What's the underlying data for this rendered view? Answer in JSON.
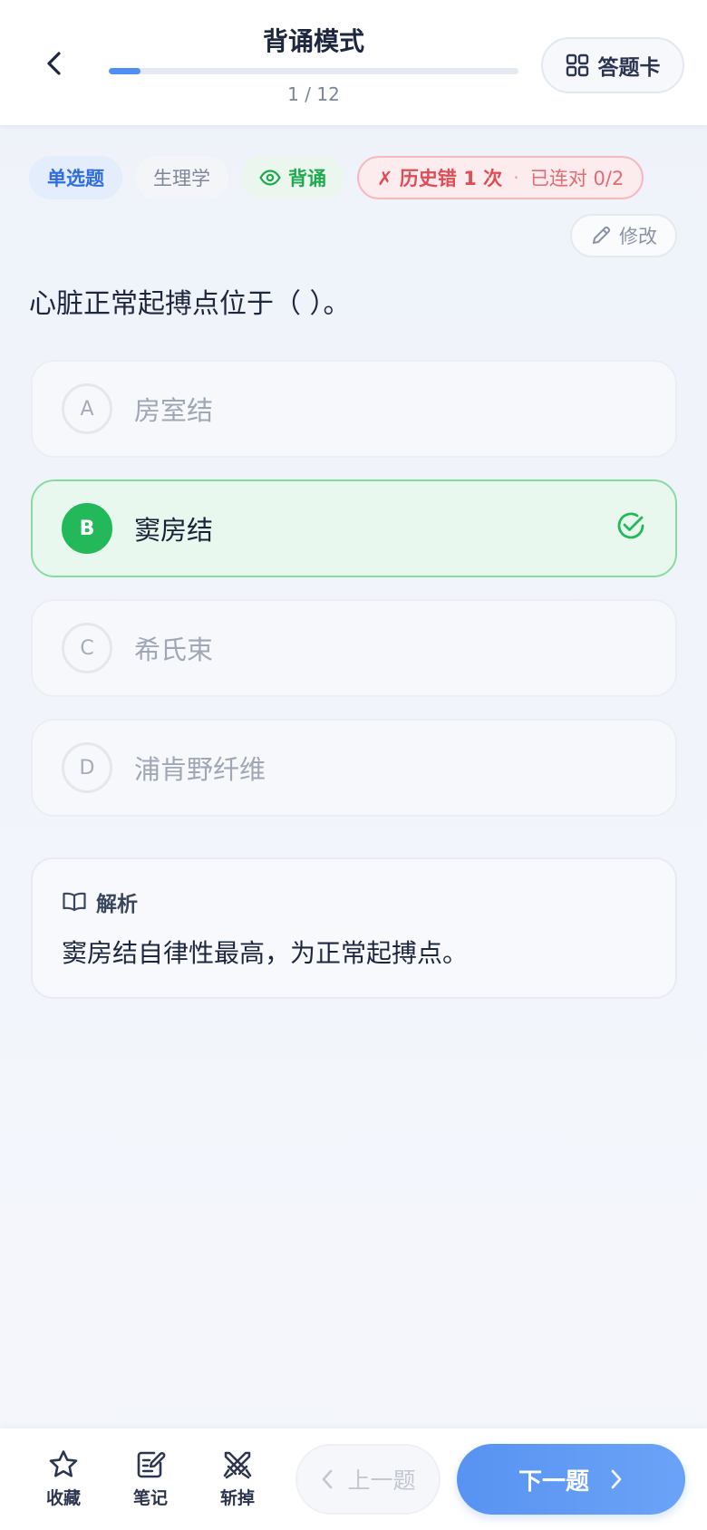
{
  "header": {
    "title": "背诵模式",
    "progress_text": "1 / 12",
    "progress_fraction": 0.0769,
    "answer_card_label": "答题卡"
  },
  "tags": {
    "type": "单选题",
    "subject": "生理学",
    "mode": "背诵",
    "history_error": "✗ 历史错 1 次",
    "history_dot": "·",
    "history_streak": "已连对 0/2"
  },
  "edit_label": "修改",
  "question": "心脏正常起搏点位于（ ）。",
  "options": [
    {
      "letter": "A",
      "text": "房室结",
      "correct": false
    },
    {
      "letter": "B",
      "text": "窦房结",
      "correct": true
    },
    {
      "letter": "C",
      "text": "希氏束",
      "correct": false
    },
    {
      "letter": "D",
      "text": "浦肯野纤维",
      "correct": false
    }
  ],
  "analysis": {
    "title": "解析",
    "body": "窦房结自律性最高，为正常起搏点。"
  },
  "bottom": {
    "favorite_label": "收藏",
    "note_label": "笔记",
    "remove_label": "斩掉",
    "prev_label": "上一题",
    "next_label": "下一题"
  },
  "colors": {
    "accent": "#4f8ef2",
    "correct": "#23b85a",
    "error": "#e14b55"
  }
}
